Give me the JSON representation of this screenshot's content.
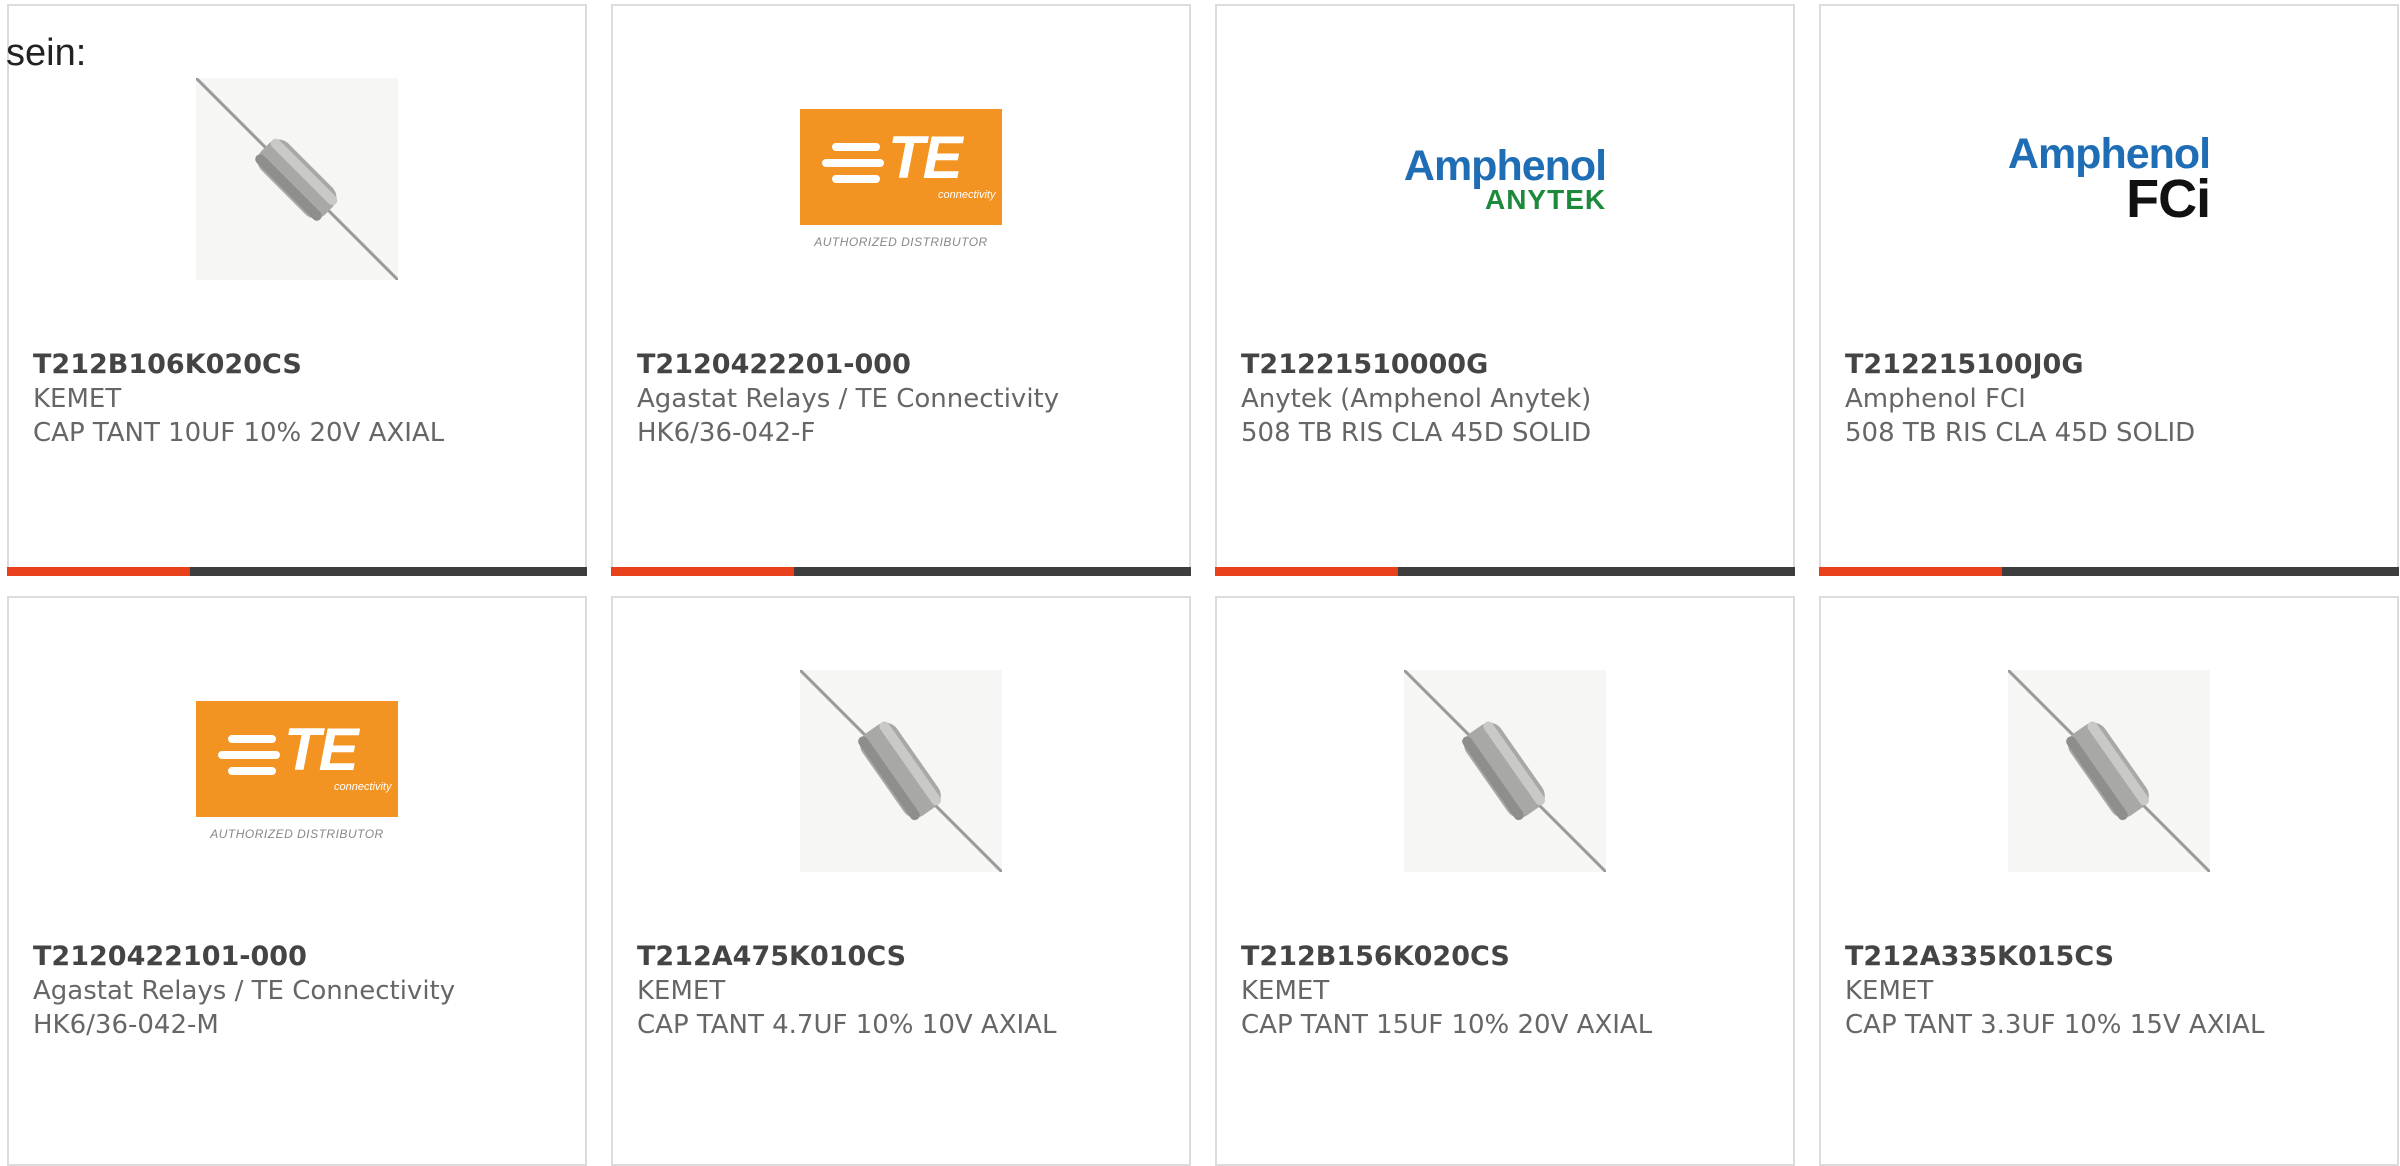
{
  "intro_text": "sein:",
  "colors": {
    "accent": "#e8401a",
    "bar": "#3d3d3d",
    "te_orange": "#f39321",
    "amphenol_blue": "#1f6db4",
    "anytek_green": "#1c8a3a"
  },
  "products": [
    {
      "image": "axial-capacitor-icon",
      "part_number": "T212B106K020CS",
      "manufacturer": "KEMET",
      "description": "CAP TANT 10UF 10% 20V AXIAL"
    },
    {
      "image": "te-connectivity-logo",
      "logo_text": "TE",
      "logo_sub": "connectivity",
      "logo_caption": "AUTHORIZED DISTRIBUTOR",
      "part_number": "T2120422201-000",
      "manufacturer": "Agastat Relays / TE Connectivity",
      "description": "HK6/36-042-F"
    },
    {
      "image": "amphenol-anytek-logo",
      "logo_text": "Amphenol",
      "logo_sub": "ANYTEK",
      "part_number": "T21221510000G",
      "manufacturer": "Anytek (Amphenol Anytek)",
      "description": "508 TB RIS CLA 45D SOLID"
    },
    {
      "image": "amphenol-fci-logo",
      "logo_text": "Amphenol",
      "logo_sub": "FCi",
      "part_number": "T212215100J0G",
      "manufacturer": "Amphenol FCI",
      "description": "508 TB RIS CLA 45D SOLID"
    },
    {
      "image": "te-connectivity-logo",
      "logo_text": "TE",
      "logo_sub": "connectivity",
      "logo_caption": "AUTHORIZED DISTRIBUTOR",
      "part_number": "T2120422101-000",
      "manufacturer": "Agastat Relays / TE Connectivity",
      "description": "HK6/36-042-M"
    },
    {
      "image": "axial-capacitor-icon",
      "part_number": "T212A475K010CS",
      "manufacturer": "KEMET",
      "description": "CAP TANT 4.7UF 10% 10V AXIAL"
    },
    {
      "image": "axial-capacitor-icon",
      "part_number": "T212B156K020CS",
      "manufacturer": "KEMET",
      "description": "CAP TANT 15UF 10% 20V AXIAL"
    },
    {
      "image": "axial-capacitor-icon",
      "part_number": "T212A335K015CS",
      "manufacturer": "KEMET",
      "description": "CAP TANT 3.3UF 10% 15V AXIAL"
    }
  ]
}
